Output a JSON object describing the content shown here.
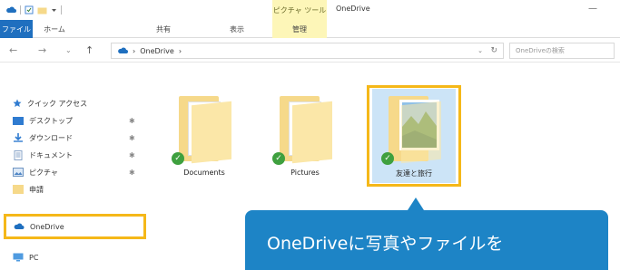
{
  "window": {
    "context_tab": "ピクチャ ツール",
    "title": "OneDrive",
    "minimize_glyph": "—"
  },
  "ribbon": {
    "tabs": [
      "ファイル",
      "ホーム",
      "共有",
      "表示",
      "管理"
    ]
  },
  "address": {
    "back": "←",
    "forward": "→",
    "recent": "⌄",
    "up": "↑",
    "path": "OneDrive",
    "path_sep": "›",
    "dropdown": "⌄",
    "refresh": "↻",
    "search_placeholder": "OneDriveの検索"
  },
  "nav": {
    "quick_access": "クイック アクセス",
    "items": [
      {
        "label": "デスクトップ",
        "icon": "desktop-icon",
        "pinned": true
      },
      {
        "label": "ダウンロード",
        "icon": "download-icon",
        "pinned": true
      },
      {
        "label": "ドキュメント",
        "icon": "document-icon",
        "pinned": true
      },
      {
        "label": "ピクチャ",
        "icon": "pictures-icon",
        "pinned": true
      },
      {
        "label": "申請",
        "icon": "folder-icon",
        "pinned": false
      }
    ],
    "onedrive": "OneDrive",
    "pc": "PC",
    "pin_glyph": "✱"
  },
  "folders": [
    {
      "name": "Documents",
      "synced": true,
      "selected": false
    },
    {
      "name": "Pictures",
      "synced": true,
      "selected": false
    },
    {
      "name": "友達と旅行",
      "synced": true,
      "selected": true
    }
  ],
  "callout": {
    "text": "OneDriveに写真やファイルを"
  },
  "colors": {
    "accent_blue": "#1f6fbf",
    "callout_blue": "#1d84c6",
    "highlight_yellow": "#f5b819",
    "context_tab_yellow": "#fdf6b8",
    "sync_green": "#3fa03f"
  }
}
